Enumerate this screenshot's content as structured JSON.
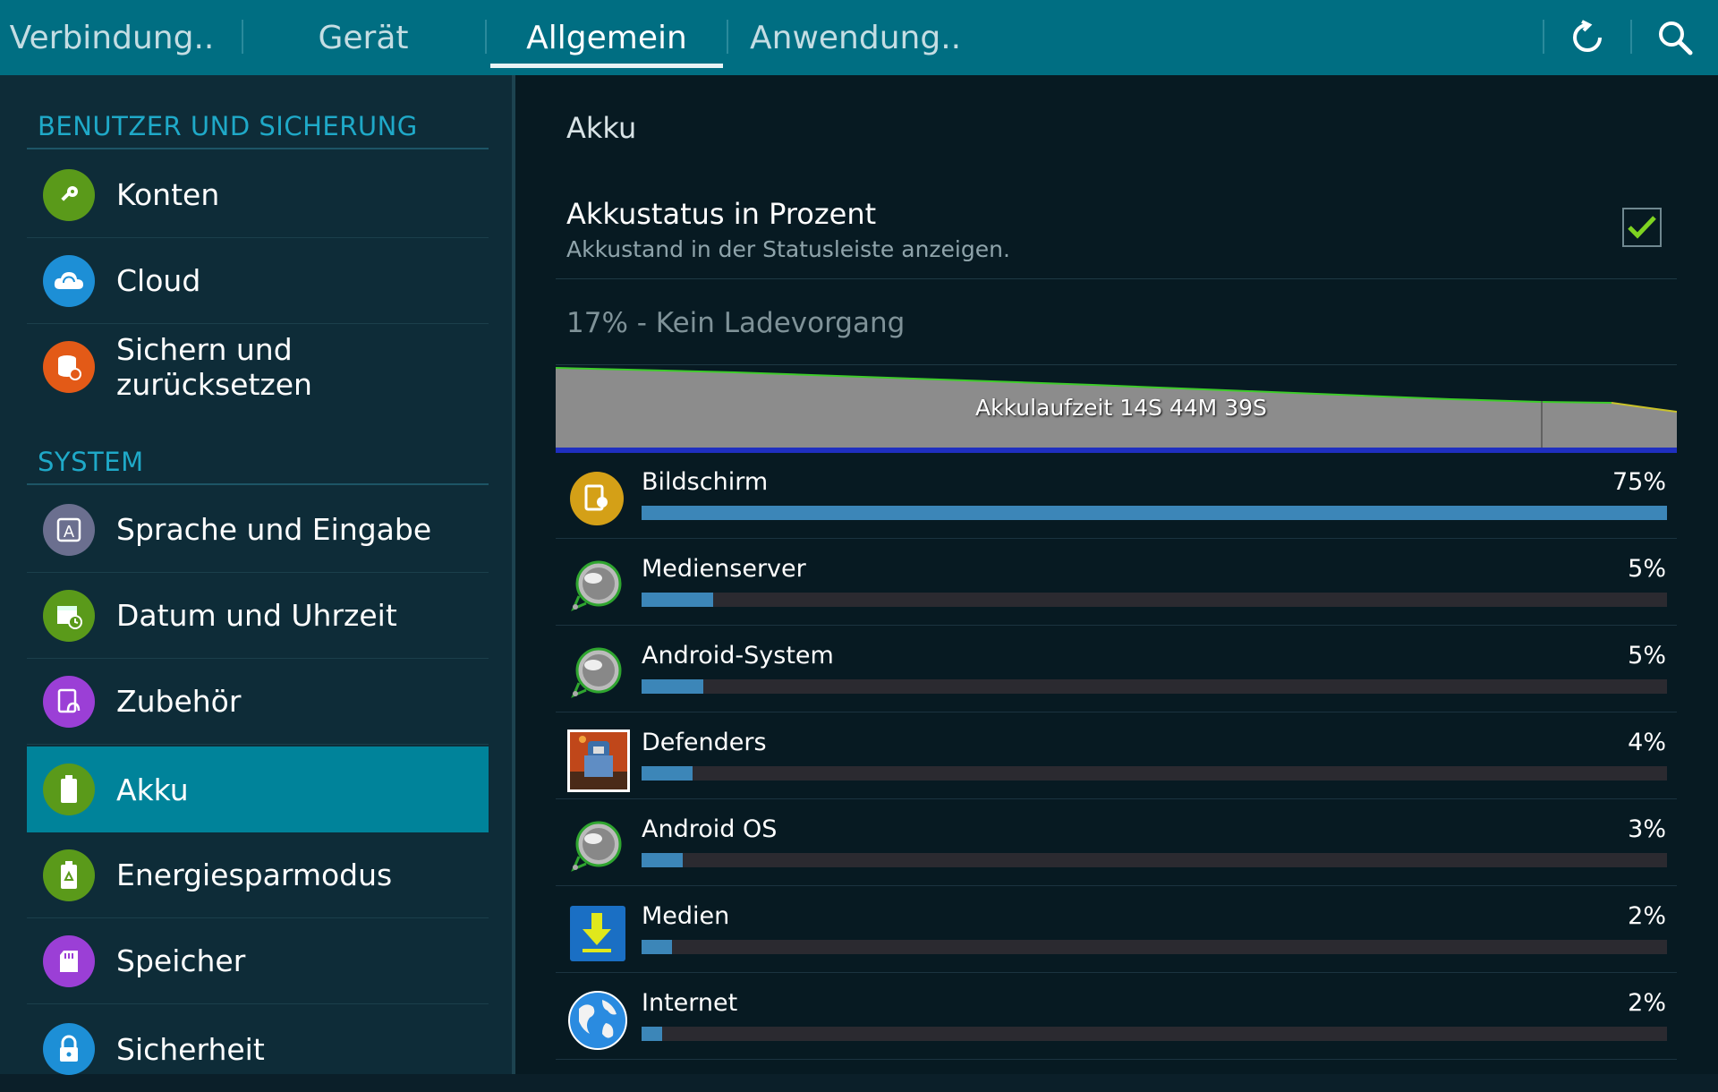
{
  "tabs": [
    {
      "label": "Verbindung..",
      "active": false
    },
    {
      "label": "Gerät",
      "active": false
    },
    {
      "label": "Allgemein",
      "active": true
    },
    {
      "label": "Anwendung..",
      "active": false
    }
  ],
  "toolbar": {
    "refresh_icon": "refresh-icon",
    "search_icon": "search-icon"
  },
  "sidebar": {
    "section1": "BENUTZER UND SICHERUNG",
    "section2": "SYSTEM",
    "items": [
      {
        "label": "Konten",
        "icon": "key-icon",
        "color": "#5a9a1a"
      },
      {
        "label": "Cloud",
        "icon": "cloud-icon",
        "color": "#1d8fd6"
      },
      {
        "label": "Sichern und zurücksetzen",
        "icon": "backup-icon",
        "color": "#e35a17"
      },
      {
        "label": "Sprache und Eingabe",
        "icon": "language-icon",
        "color": "#6b6f8f"
      },
      {
        "label": "Datum und Uhrzeit",
        "icon": "calendar-clock-icon",
        "color": "#5a9a1a"
      },
      {
        "label": "Zubehör",
        "icon": "accessory-icon",
        "color": "#9b3fd6"
      },
      {
        "label": "Akku",
        "icon": "battery-icon",
        "color": "#5a9a1a",
        "selected": true
      },
      {
        "label": "Energiesparmodus",
        "icon": "power-saving-icon",
        "color": "#5a9a1a"
      },
      {
        "label": "Speicher",
        "icon": "storage-icon",
        "color": "#9b3fd6"
      },
      {
        "label": "Sicherheit",
        "icon": "lock-icon",
        "color": "#1d8fd6"
      }
    ]
  },
  "main": {
    "title": "Akku",
    "percent_pref": {
      "title": "Akkustatus in Prozent",
      "subtitle": "Akkustand in der Statusleiste anzeigen.",
      "checked": true
    },
    "status": "17% - Kein Ladevorgang",
    "graph_label": "Akkulaufzeit 14S 44M 39S",
    "apps": [
      {
        "name": "Bildschirm",
        "pct": "75%",
        "value": 1.0,
        "icon": "screen-icon"
      },
      {
        "name": "Medienserver",
        "pct": "5%",
        "value": 0.07,
        "icon": "media-server-icon"
      },
      {
        "name": "Android-System",
        "pct": "5%",
        "value": 0.06,
        "icon": "android-system-icon"
      },
      {
        "name": "Defenders",
        "pct": "4%",
        "value": 0.05,
        "icon": "game-icon"
      },
      {
        "name": "Android OS",
        "pct": "3%",
        "value": 0.04,
        "icon": "android-os-icon"
      },
      {
        "name": "Medien",
        "pct": "2%",
        "value": 0.03,
        "icon": "download-icon"
      },
      {
        "name": "Internet",
        "pct": "2%",
        "value": 0.02,
        "icon": "globe-icon"
      }
    ]
  }
}
